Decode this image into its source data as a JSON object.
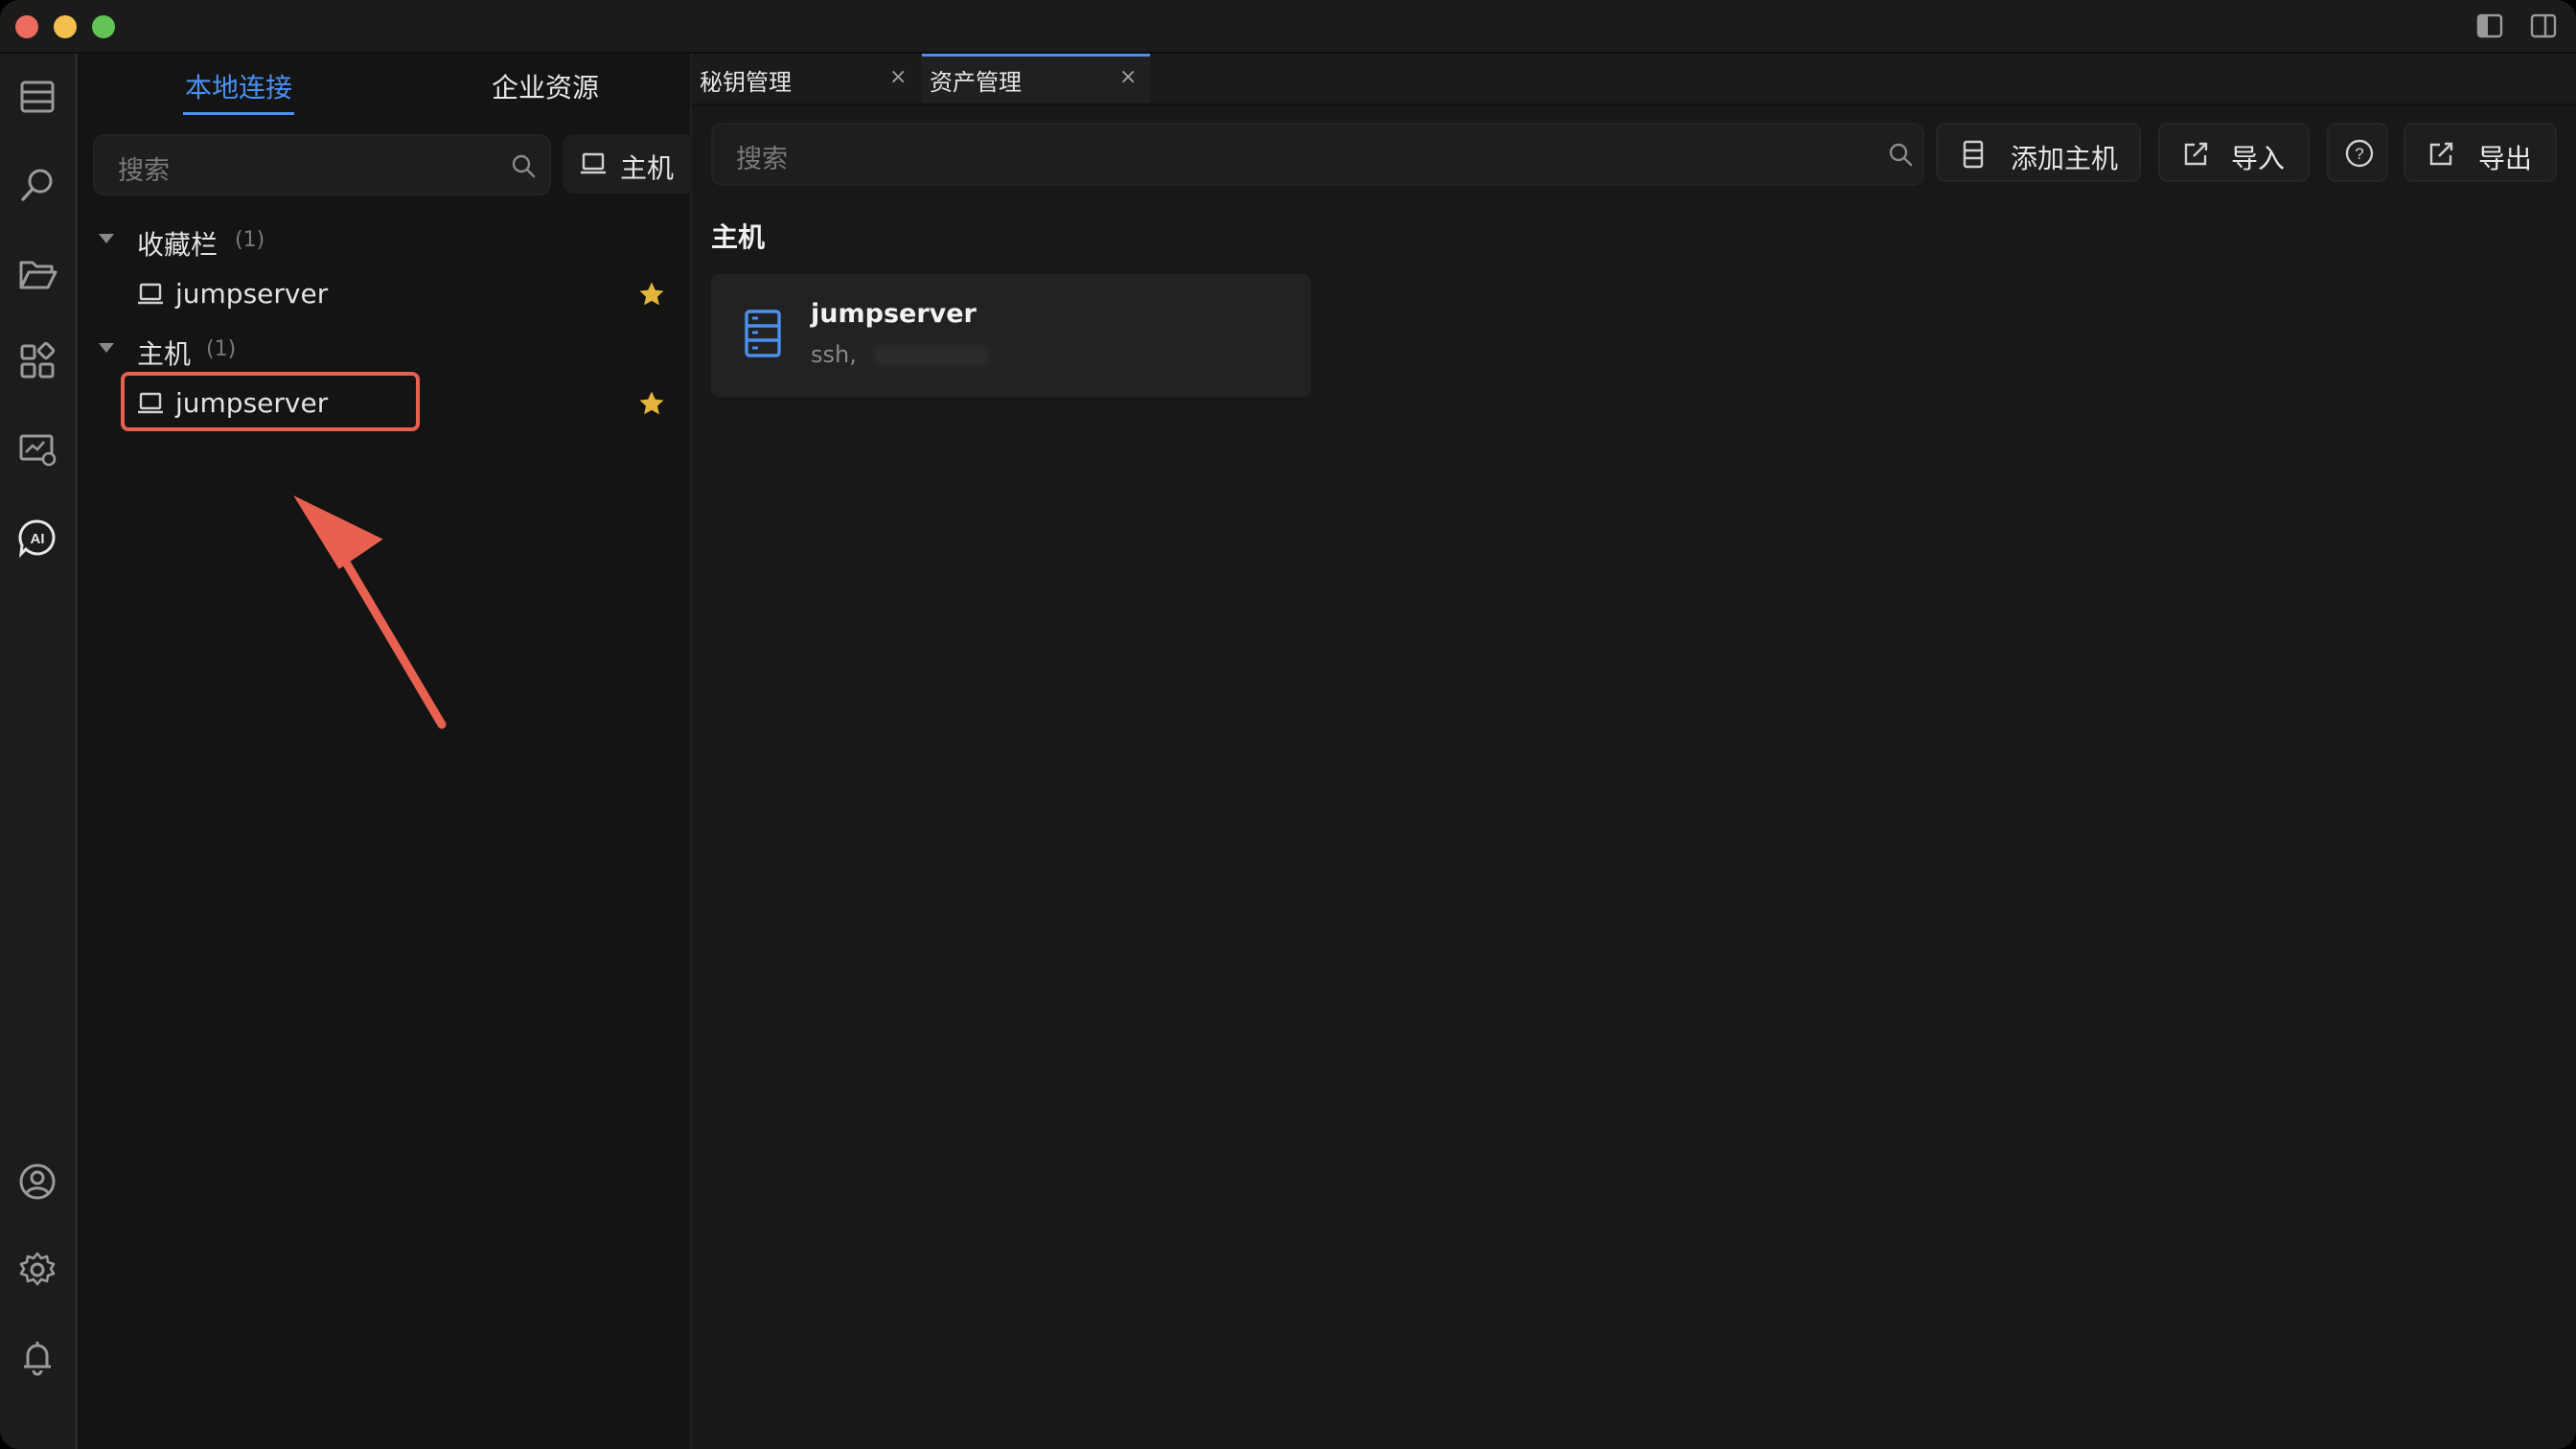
{
  "titlebar": {
    "icons": [
      "toggle-left-sidebar-icon",
      "toggle-right-panel-icon"
    ]
  },
  "activity": {
    "top_icons": [
      "hosts-list-icon",
      "search-icon",
      "folder-icon",
      "apps-icon",
      "monitor-icon",
      "ai-assistant-icon"
    ],
    "bottom_icons": [
      "user-icon",
      "settings-icon",
      "notification-bell-icon"
    ]
  },
  "sidebar": {
    "tabs": [
      {
        "label": "本地连接"
      },
      {
        "label": "企业资源"
      }
    ],
    "search": {
      "placeholder": "搜索"
    },
    "host_filter": {
      "label": "主机"
    },
    "tree": {
      "favorites": {
        "label": "收藏栏",
        "count": "(1)",
        "items": [
          {
            "label": "jumpserver"
          }
        ]
      },
      "hosts": {
        "label": "主机",
        "count": "(1)",
        "items": [
          {
            "label": "jumpserver"
          }
        ]
      }
    }
  },
  "main": {
    "tabs": [
      {
        "label": "秘钥管理",
        "close": "×"
      },
      {
        "label": "资产管理",
        "close": "×"
      }
    ],
    "search": {
      "placeholder": "搜索"
    },
    "buttons": {
      "add_host": "添加主机",
      "import": "导入",
      "export": "导出"
    },
    "section_title": "主机",
    "host_card": {
      "name": "jumpserver",
      "protocol": "ssh,"
    }
  },
  "colors": {
    "accent": "#4c8ff0",
    "annotation": "#e8604f",
    "star": "#e3b53c"
  }
}
